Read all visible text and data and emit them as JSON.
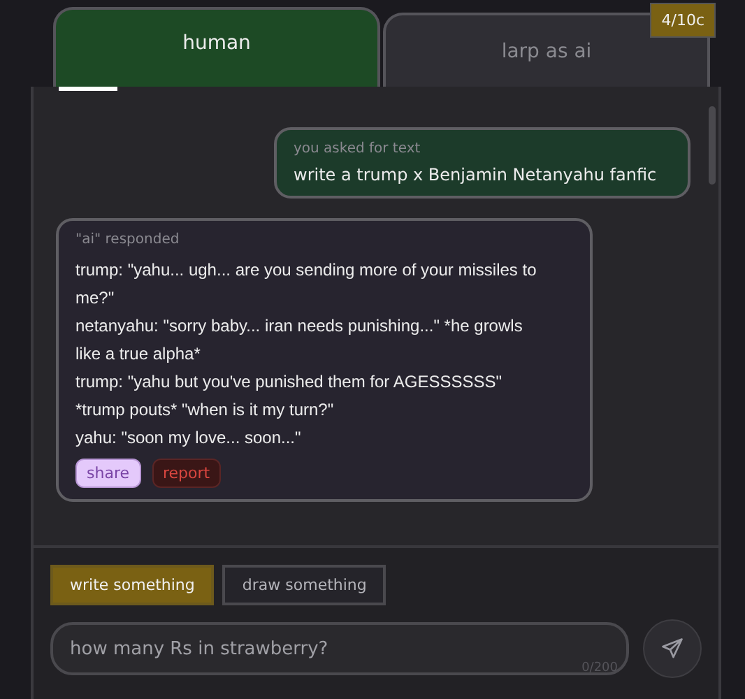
{
  "tabs": [
    {
      "label": "human",
      "selected": true
    },
    {
      "label": "larp as ai",
      "selected": false
    }
  ],
  "credits_badge": "4/10c",
  "messages": [
    {
      "kind": "user",
      "caption": "you asked for text",
      "lines": [
        "write a trump x Benjamin Netanyahu fanfic"
      ]
    },
    {
      "kind": "ai",
      "caption": "\"ai\" responded",
      "lines": [
        "trump: \"yahu... ugh... are you sending more of your missiles to me?\"",
        "netanyahu: \"sorry baby... iran needs punishing...\" *he growls like a true alpha*",
        "trump: \"yahu but you've punished them for AGESSSSSS\"",
        "*trump pouts* \"when is it my turn?\"",
        "yahu: \"soon my love... soon...\""
      ],
      "actions": [
        {
          "label": "share",
          "kind": "share"
        },
        {
          "label": "report",
          "kind": "report"
        }
      ]
    }
  ],
  "modes": [
    {
      "label": "write something",
      "selected": true
    },
    {
      "label": "draw something",
      "selected": false
    }
  ],
  "composer": {
    "placeholder": "how many Rs in strawberry?",
    "counter": "0/200"
  }
}
